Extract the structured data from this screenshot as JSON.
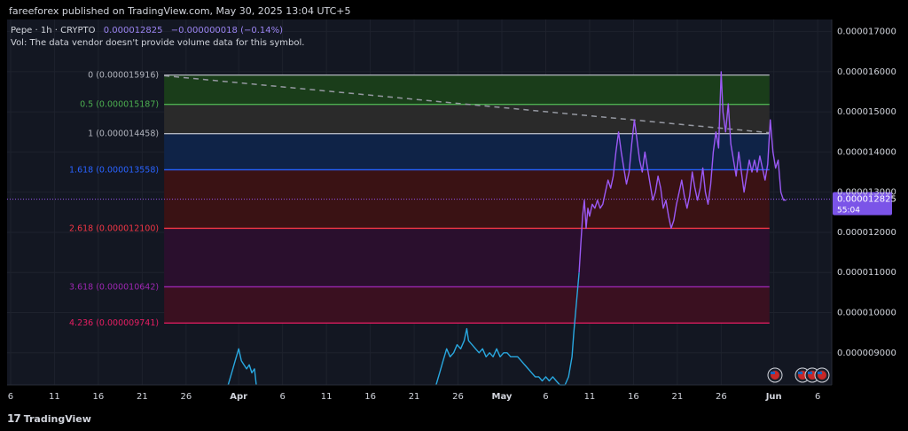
{
  "header": {
    "publisher": "fareeforex published on TradingView.com, May 30, 2025 13:04 UTC+5"
  },
  "legend": {
    "symbol": "Pepe · 1h · CRYPTO",
    "price": "0.000012825",
    "change": "−0.000000018 (−0.14%)",
    "volume_note": "Vol: The data vendor doesn't provide volume data for this symbol."
  },
  "footer": {
    "logo_text": "TradingView",
    "logo_icon": "tradingview-logo-icon"
  },
  "colors": {
    "background": "#131722",
    "grid": "#1e222d",
    "axis_text": "#d1d4dc",
    "price_line_purple": "#9b59f5",
    "price_line_blue": "#29a8e0",
    "current_price_bg": "#7b54e8",
    "dashed_trend": "#9598a1"
  },
  "chart_data": {
    "type": "line",
    "title": "",
    "xlabel": "",
    "ylabel": "",
    "ylim": [
      8.2e-06,
      1.73e-05
    ],
    "y_ticks": [
      "0.000017000",
      "0.000016000",
      "0.000015000",
      "0.000014000",
      "0.000013000",
      "0.000012000",
      "0.000011000",
      "0.000010000",
      "0.000009000"
    ],
    "y_tick_values": [
      1.7e-05,
      1.6e-05,
      1.5e-05,
      1.4e-05,
      1.3e-05,
      1.2e-05,
      1.1e-05,
      1e-05,
      9e-06
    ],
    "x_ticks": [
      "6",
      "11",
      "16",
      "21",
      "26",
      "Apr",
      "6",
      "11",
      "16",
      "21",
      "26",
      "May",
      "6",
      "11",
      "16",
      "21",
      "26",
      "Jun",
      "6"
    ],
    "x_tick_days": [
      0,
      5,
      10,
      15,
      20,
      26,
      31,
      36,
      41,
      46,
      51,
      56,
      61,
      66,
      71,
      76,
      81,
      87,
      92
    ],
    "current_price": {
      "label": "0.000012825",
      "countdown": "55:04",
      "value": 1.2825e-05
    },
    "fib_levels": [
      {
        "label": "0 (0.000015916)",
        "value": 1.5916e-05,
        "color": "#b2b5be"
      },
      {
        "label": "0.5 (0.000015187)",
        "value": 1.5187e-05,
        "color": "#4caf50"
      },
      {
        "label": "1 (0.000014458)",
        "value": 1.4458e-05,
        "color": "#b2b5be"
      },
      {
        "label": "1.618 (0.000013558)",
        "value": 1.3558e-05,
        "color": "#2962ff"
      },
      {
        "label": "2.618 (0.000012100)",
        "value": 1.21e-05,
        "color": "#f23645"
      },
      {
        "label": "3.618 (0.000010642)",
        "value": 1.0642e-05,
        "color": "#9c27b0"
      },
      {
        "label": "4.236 (0.000009741)",
        "value": 9.741e-06,
        "color": "#e91e63"
      }
    ],
    "fib_bands": [
      {
        "from": 1.5916e-05,
        "to": 1.5187e-05,
        "color": "#1a3d1a"
      },
      {
        "from": 1.5187e-05,
        "to": 1.4458e-05,
        "color": "#2a2a2a"
      },
      {
        "from": 1.4458e-05,
        "to": 1.3558e-05,
        "color": "#0f2347"
      },
      {
        "from": 1.3558e-05,
        "to": 1.21e-05,
        "color": "#3a1214"
      },
      {
        "from": 1.21e-05,
        "to": 1.0642e-05,
        "color": "#2a0f2d"
      },
      {
        "from": 1.0642e-05,
        "to": 9.741e-06,
        "color": "#3a1020"
      }
    ],
    "trend_line": {
      "from": {
        "day": 17.5,
        "value": 1.59e-05
      },
      "to": {
        "day": 86.5,
        "value": 1.448e-05
      }
    },
    "series": [
      {
        "color": "#29a8e0",
        "points": [
          [
            24.8,
            8.2e-06
          ],
          [
            25.2,
            8.5e-06
          ],
          [
            25.6,
            8.8e-06
          ],
          [
            26.0,
            9.1e-06
          ],
          [
            26.3,
            8.8e-06
          ],
          [
            26.6,
            8.7e-06
          ],
          [
            26.9,
            8.6e-06
          ],
          [
            27.2,
            8.7e-06
          ],
          [
            27.5,
            8.5e-06
          ],
          [
            27.8,
            8.6e-06
          ],
          [
            28.0,
            8.2e-06
          ]
        ]
      },
      {
        "color": "#29a8e0",
        "points": [
          [
            48.5,
            8.2e-06
          ],
          [
            48.9,
            8.5e-06
          ],
          [
            49.3,
            8.8e-06
          ],
          [
            49.7,
            9.1e-06
          ],
          [
            50.1,
            8.9e-06
          ],
          [
            50.5,
            9e-06
          ],
          [
            50.9,
            9.2e-06
          ],
          [
            51.3,
            9.1e-06
          ],
          [
            51.7,
            9.3e-06
          ],
          [
            52.0,
            9.6e-06
          ],
          [
            52.2,
            9.3e-06
          ],
          [
            52.6,
            9.2e-06
          ],
          [
            53.0,
            9.1e-06
          ],
          [
            53.4,
            9e-06
          ],
          [
            53.8,
            9.1e-06
          ],
          [
            54.2,
            8.9e-06
          ],
          [
            54.6,
            9e-06
          ],
          [
            55.0,
            8.9e-06
          ],
          [
            55.4,
            9.1e-06
          ],
          [
            55.8,
            8.9e-06
          ],
          [
            56.2,
            9e-06
          ],
          [
            56.6,
            9e-06
          ],
          [
            57.0,
            8.9e-06
          ],
          [
            57.4,
            8.9e-06
          ],
          [
            57.8,
            8.9e-06
          ],
          [
            58.2,
            8.8e-06
          ],
          [
            58.6,
            8.7e-06
          ],
          [
            59.0,
            8.6e-06
          ],
          [
            59.4,
            8.5e-06
          ],
          [
            59.8,
            8.4e-06
          ],
          [
            60.2,
            8.4e-06
          ],
          [
            60.6,
            8.3e-06
          ],
          [
            61.0,
            8.4e-06
          ],
          [
            61.4,
            8.3e-06
          ],
          [
            61.8,
            8.4e-06
          ],
          [
            62.2,
            8.3e-06
          ],
          [
            62.6,
            8.2e-06
          ],
          [
            63.2,
            8.2e-06
          ],
          [
            63.6,
            8.4e-06
          ],
          [
            64.0,
            8.9e-06
          ],
          [
            64.2,
            9.5e-06
          ],
          [
            64.4,
            1e-05
          ],
          [
            64.6,
            1.05e-05
          ],
          [
            64.8,
            1.1e-05
          ]
        ]
      },
      {
        "color": "#9b59f5",
        "points": [
          [
            64.8,
            1.1e-05
          ],
          [
            65.0,
            1.17e-05
          ],
          [
            65.2,
            1.24e-05
          ],
          [
            65.4,
            1.28e-05
          ],
          [
            65.6,
            1.21e-05
          ],
          [
            65.8,
            1.26e-05
          ],
          [
            66.0,
            1.24e-05
          ],
          [
            66.3,
            1.27e-05
          ],
          [
            66.6,
            1.26e-05
          ],
          [
            66.9,
            1.28e-05
          ],
          [
            67.2,
            1.26e-05
          ],
          [
            67.5,
            1.27e-05
          ],
          [
            67.8,
            1.3e-05
          ],
          [
            68.1,
            1.33e-05
          ],
          [
            68.4,
            1.31e-05
          ],
          [
            68.7,
            1.34e-05
          ],
          [
            69.0,
            1.4e-05
          ],
          [
            69.3,
            1.45e-05
          ],
          [
            69.6,
            1.4e-05
          ],
          [
            69.9,
            1.36e-05
          ],
          [
            70.2,
            1.32e-05
          ],
          [
            70.5,
            1.35e-05
          ],
          [
            70.8,
            1.42e-05
          ],
          [
            71.1,
            1.48e-05
          ],
          [
            71.4,
            1.43e-05
          ],
          [
            71.7,
            1.38e-05
          ],
          [
            72.0,
            1.35e-05
          ],
          [
            72.3,
            1.4e-05
          ],
          [
            72.6,
            1.36e-05
          ],
          [
            72.9,
            1.32e-05
          ],
          [
            73.2,
            1.28e-05
          ],
          [
            73.5,
            1.3e-05
          ],
          [
            73.8,
            1.34e-05
          ],
          [
            74.1,
            1.31e-05
          ],
          [
            74.4,
            1.26e-05
          ],
          [
            74.7,
            1.28e-05
          ],
          [
            75.0,
            1.24e-05
          ],
          [
            75.3,
            1.21e-05
          ],
          [
            75.6,
            1.23e-05
          ],
          [
            75.9,
            1.27e-05
          ],
          [
            76.2,
            1.3e-05
          ],
          [
            76.5,
            1.33e-05
          ],
          [
            76.8,
            1.29e-05
          ],
          [
            77.1,
            1.26e-05
          ],
          [
            77.4,
            1.29e-05
          ],
          [
            77.7,
            1.35e-05
          ],
          [
            78.0,
            1.31e-05
          ],
          [
            78.3,
            1.28e-05
          ],
          [
            78.6,
            1.31e-05
          ],
          [
            78.9,
            1.36e-05
          ],
          [
            79.2,
            1.3e-05
          ],
          [
            79.5,
            1.27e-05
          ],
          [
            79.8,
            1.32e-05
          ],
          [
            80.1,
            1.4e-05
          ],
          [
            80.4,
            1.45e-05
          ],
          [
            80.7,
            1.41e-05
          ],
          [
            81.0,
            1.6e-05
          ],
          [
            81.2,
            1.5e-05
          ],
          [
            81.5,
            1.45e-05
          ],
          [
            81.8,
            1.52e-05
          ],
          [
            82.1,
            1.42e-05
          ],
          [
            82.4,
            1.38e-05
          ],
          [
            82.7,
            1.34e-05
          ],
          [
            83.0,
            1.4e-05
          ],
          [
            83.3,
            1.35e-05
          ],
          [
            83.6,
            1.3e-05
          ],
          [
            83.9,
            1.34e-05
          ],
          [
            84.2,
            1.38e-05
          ],
          [
            84.5,
            1.35e-05
          ],
          [
            84.8,
            1.38e-05
          ],
          [
            85.1,
            1.35e-05
          ],
          [
            85.4,
            1.39e-05
          ],
          [
            85.7,
            1.36e-05
          ],
          [
            86.0,
            1.33e-05
          ],
          [
            86.3,
            1.37e-05
          ],
          [
            86.6,
            1.48e-05
          ],
          [
            86.9,
            1.4e-05
          ],
          [
            87.2,
            1.36e-05
          ],
          [
            87.5,
            1.38e-05
          ],
          [
            87.8,
            1.3e-05
          ],
          [
            88.1,
            1.28e-05
          ],
          [
            88.4,
            1.28e-05
          ]
        ]
      }
    ]
  }
}
